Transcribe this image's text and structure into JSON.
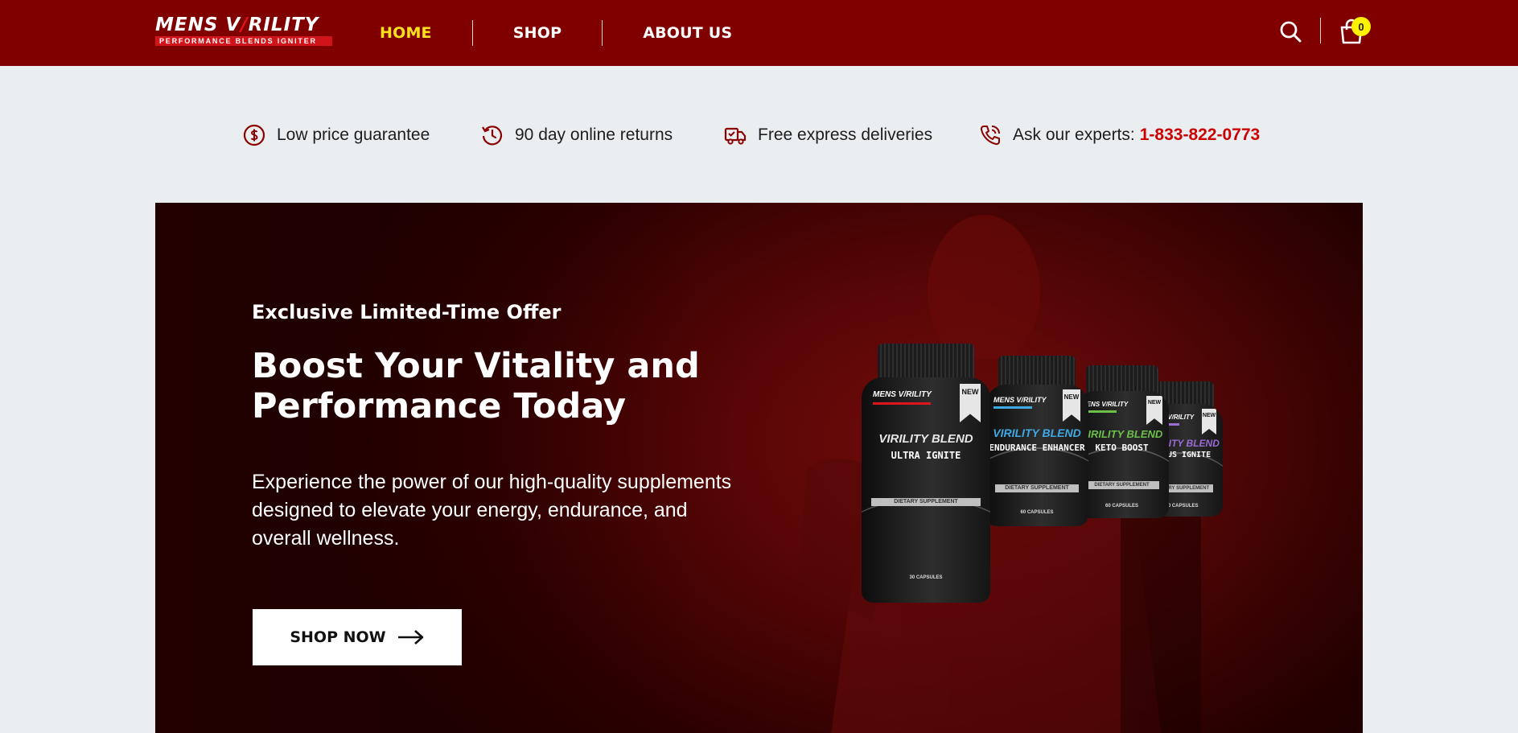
{
  "header": {
    "logo": {
      "main_prefix": "MENS V",
      "main_slash": "/",
      "main_suffix": "RILITY",
      "tagline": "PERFORMANCE BLENDS IGNITER"
    },
    "nav": [
      {
        "label": "HOME",
        "active": true
      },
      {
        "label": "SHOP",
        "active": false
      },
      {
        "label": "ABOUT US",
        "active": false
      }
    ],
    "cart_count": "0",
    "icons": {
      "search": "search-icon",
      "cart": "shopping-bag-icon"
    }
  },
  "features": [
    {
      "icon": "dollar-circle-icon",
      "label": "Low price guarantee"
    },
    {
      "icon": "history-icon",
      "label": "90 day online returns"
    },
    {
      "icon": "delivery-truck-icon",
      "label": "Free express deliveries"
    },
    {
      "icon": "phone-icon",
      "label": "Ask our experts:",
      "phone": "1-833-822-0773"
    }
  ],
  "hero": {
    "eyebrow": "Exclusive Limited-Time Offer",
    "title": "Boost Your Vitality and Performance Today",
    "description": "Experience the power of our high-quality supplements designed to elevate your energy, endurance, and overall wellness.",
    "cta_label": "SHOP NOW",
    "products": [
      {
        "brand": "MENS V/RILITY",
        "badge": "NEW",
        "line1": "VIRILITY BLEND",
        "line2": "ULTRA IGNITE",
        "diet": "DIETARY SUPPLEMENT",
        "caps": "30 CAPSULES",
        "accent": "#e0e0e0"
      },
      {
        "brand": "MENS V/RILITY",
        "badge": "NEW",
        "line1": "VIRILITY BLEND",
        "line2": "ENDURANCE ENHANCER",
        "diet": "DIETARY SUPPLEMENT",
        "caps": "60 CAPSULES",
        "accent": "#3fa9e6"
      },
      {
        "brand": "MENS V/RILITY",
        "badge": "NEW",
        "line1": "VIRILITY BLEND",
        "line2": "KETO BOOST",
        "diet": "DIETARY SUPPLEMENT",
        "caps": "60 CAPSULES",
        "accent": "#6cc04a"
      },
      {
        "brand": "MENS V/RILITY",
        "badge": "NEW",
        "line1": "VIRILITY BLEND",
        "line2": "FOCUS IGNITE",
        "diet": "DIETARY SUPPLEMENT",
        "caps": "60 CAPSULES",
        "accent": "#9b6bd6"
      }
    ]
  },
  "colors": {
    "header_bg": "#800000",
    "nav_active": "#ffe21a",
    "accent_red": "#cc0000",
    "page_bg": "#ebeef1",
    "badge": "#fff200"
  }
}
